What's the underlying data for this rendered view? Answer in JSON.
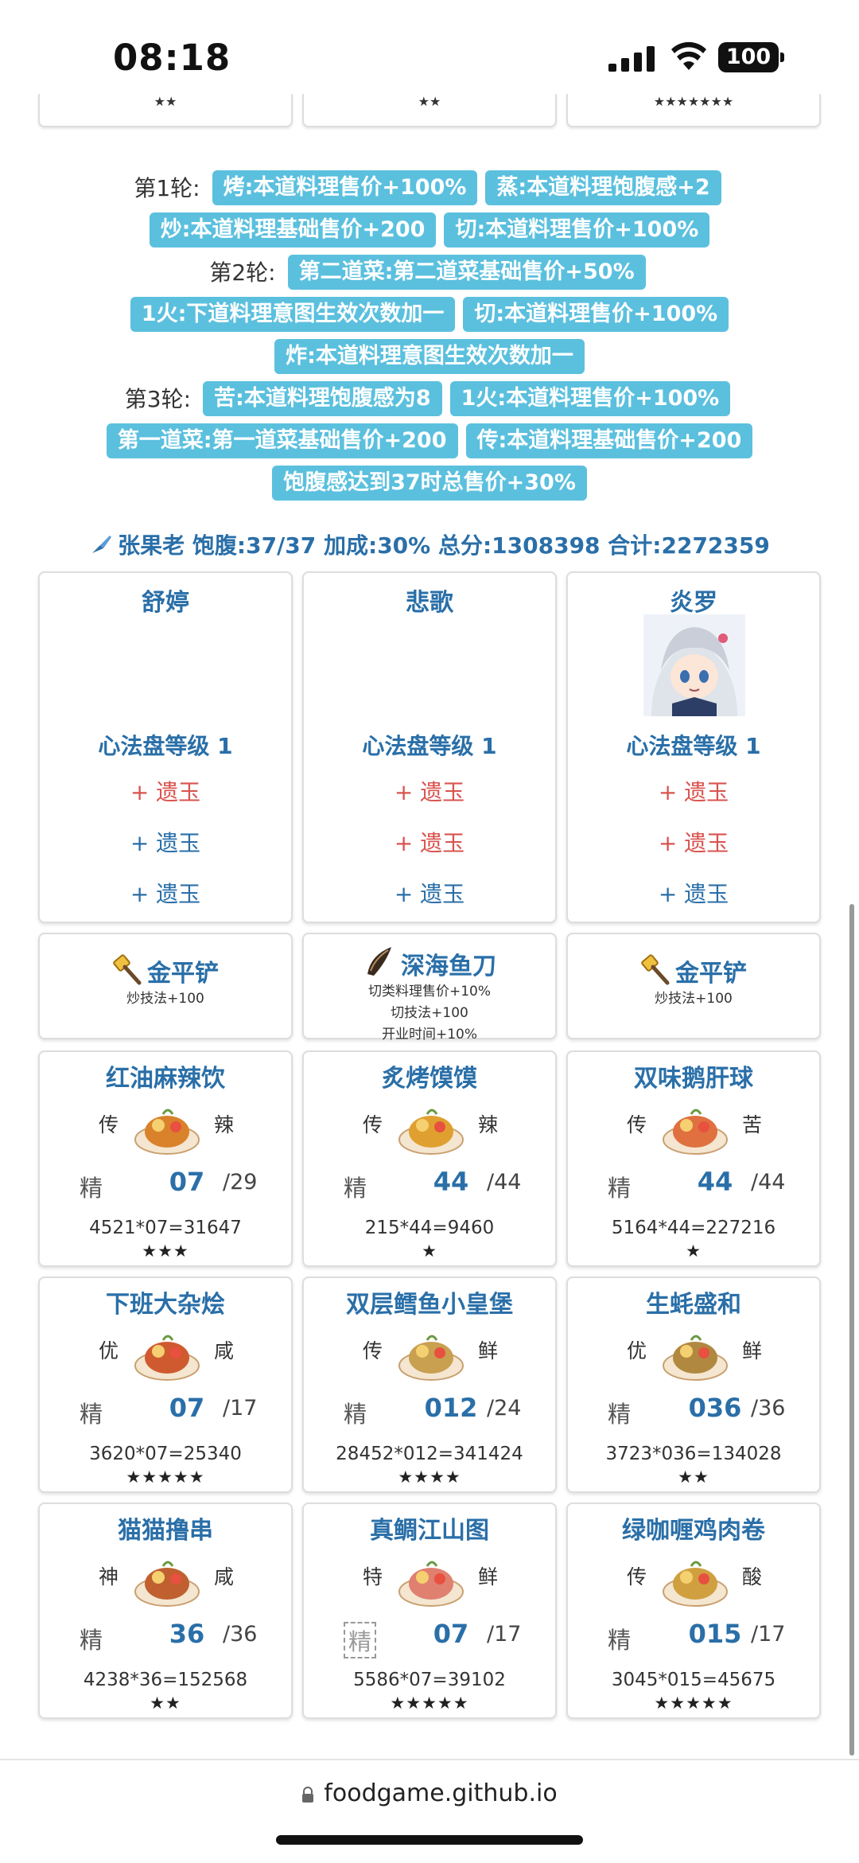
{
  "status": {
    "time": "08:18",
    "battery": "100"
  },
  "top_cards": [
    "★★",
    "★★",
    "★★★★★★★"
  ],
  "rounds": [
    {
      "label": "第1轮:",
      "lines": [
        [
          "烤:本道料理售价+100%",
          "蒸:本道料理饱腹感+2"
        ],
        [
          "炒:本道料理基础售价+200",
          "切:本道料理售价+100%"
        ]
      ]
    },
    {
      "label": "第2轮:",
      "lines": [
        [
          "第二道菜:第二道菜基础售价+50%"
        ],
        [
          "1火:下道料理意图生效次数加一",
          "切:本道料理售价+100%"
        ],
        [
          "炸:本道料理意图生效次数加一"
        ]
      ]
    },
    {
      "label": "第3轮:",
      "lines": [
        [
          "苦:本道料理饱腹感为8",
          "1火:本道料理售价+100%"
        ],
        [
          "第一道菜:第一道菜基础售价+200",
          "传:本道料理基础售价+200"
        ],
        [
          "饱腹感达到37时总售价+30%"
        ]
      ]
    }
  ],
  "summary": "张果老 饱腹:37/37 加成:30% 总分:1308398 合计:2272359",
  "chefs": [
    {
      "name": "舒婷",
      "level": "心法盘等级 1",
      "slots": [
        {
          "text": "+ 遗玉",
          "color": "red"
        },
        {
          "text": "+ 遗玉",
          "color": "blue"
        },
        {
          "text": "+ 遗玉",
          "color": "blue"
        }
      ],
      "avatar": false
    },
    {
      "name": "悲歌",
      "level": "心法盘等级 1",
      "slots": [
        {
          "text": "+ 遗玉",
          "color": "red"
        },
        {
          "text": "+ 遗玉",
          "color": "red"
        },
        {
          "text": "+ 遗玉",
          "color": "blue"
        }
      ],
      "avatar": false
    },
    {
      "name": "炎罗",
      "level": "心法盘等级 1",
      "slots": [
        {
          "text": "+ 遗玉",
          "color": "red"
        },
        {
          "text": "+ 遗玉",
          "color": "red"
        },
        {
          "text": "+ 遗玉",
          "color": "blue"
        }
      ],
      "avatar": true
    }
  ],
  "equips": [
    {
      "name": "金平铲",
      "icon": "spatula-icon",
      "desc": [
        "炒技法+100"
      ]
    },
    {
      "name": "深海鱼刀",
      "icon": "knife-icon",
      "desc": [
        "切类料理售价+10%",
        "切技法+100",
        "开业时间+10%"
      ]
    },
    {
      "name": "金平铲",
      "icon": "spatula-icon",
      "desc": [
        "炒技法+100"
      ]
    }
  ],
  "dishes": [
    {
      "name": "红油麻辣饮",
      "rarity": "传",
      "flavor": "辣",
      "skill": "精",
      "qty": "07",
      "max": "/29",
      "calc": "4521*07=31647",
      "stars": "★★★",
      "color": "#d9822b"
    },
    {
      "name": "炙烤馍馍",
      "rarity": "传",
      "flavor": "辣",
      "skill": "精",
      "qty": "44",
      "max": "/44",
      "calc": "215*44=9460",
      "stars": "★",
      "color": "#e0a030"
    },
    {
      "name": "双味鹅肝球",
      "rarity": "传",
      "flavor": "苦",
      "skill": "精",
      "qty": "44",
      "max": "/44",
      "calc": "5164*44=227216",
      "stars": "★",
      "color": "#e07040"
    },
    {
      "name": "下班大杂烩",
      "rarity": "优",
      "flavor": "咸",
      "skill": "精",
      "qty": "07",
      "max": "/17",
      "calc": "3620*07=25340",
      "stars": "★★★★★",
      "color": "#d05a30"
    },
    {
      "name": "双层鳕鱼小皇堡",
      "rarity": "传",
      "flavor": "鲜",
      "skill": "精",
      "qty": "012",
      "max": "/24",
      "calc": "28452*012=341424",
      "stars": "★★★★",
      "color": "#c8a050"
    },
    {
      "name": "生蚝盛和",
      "rarity": "优",
      "flavor": "鲜",
      "skill": "精",
      "qty": "036",
      "max": "/36",
      "calc": "3723*036=134028",
      "stars": "★★",
      "color": "#b08840"
    },
    {
      "name": "猫猫撸串",
      "rarity": "神",
      "flavor": "咸",
      "skill": "精",
      "qty": "36",
      "max": "/36",
      "calc": "4238*36=152568",
      "stars": "★★",
      "color": "#c06030"
    },
    {
      "name": "真鲷江山图",
      "rarity": "特",
      "flavor": "鲜",
      "skill": "精",
      "qty": "07",
      "max": "/17",
      "calc": "5586*07=39102",
      "stars": "★★★★★",
      "color": "#e08070"
    },
    {
      "name": "绿咖喱鸡肉卷",
      "rarity": "传",
      "flavor": "酸",
      "skill": "精",
      "qty": "015",
      "max": "/17",
      "calc": "3045*015=45675",
      "stars": "★★★★★",
      "color": "#d0a040"
    }
  ],
  "url": "foodgame.github.io"
}
